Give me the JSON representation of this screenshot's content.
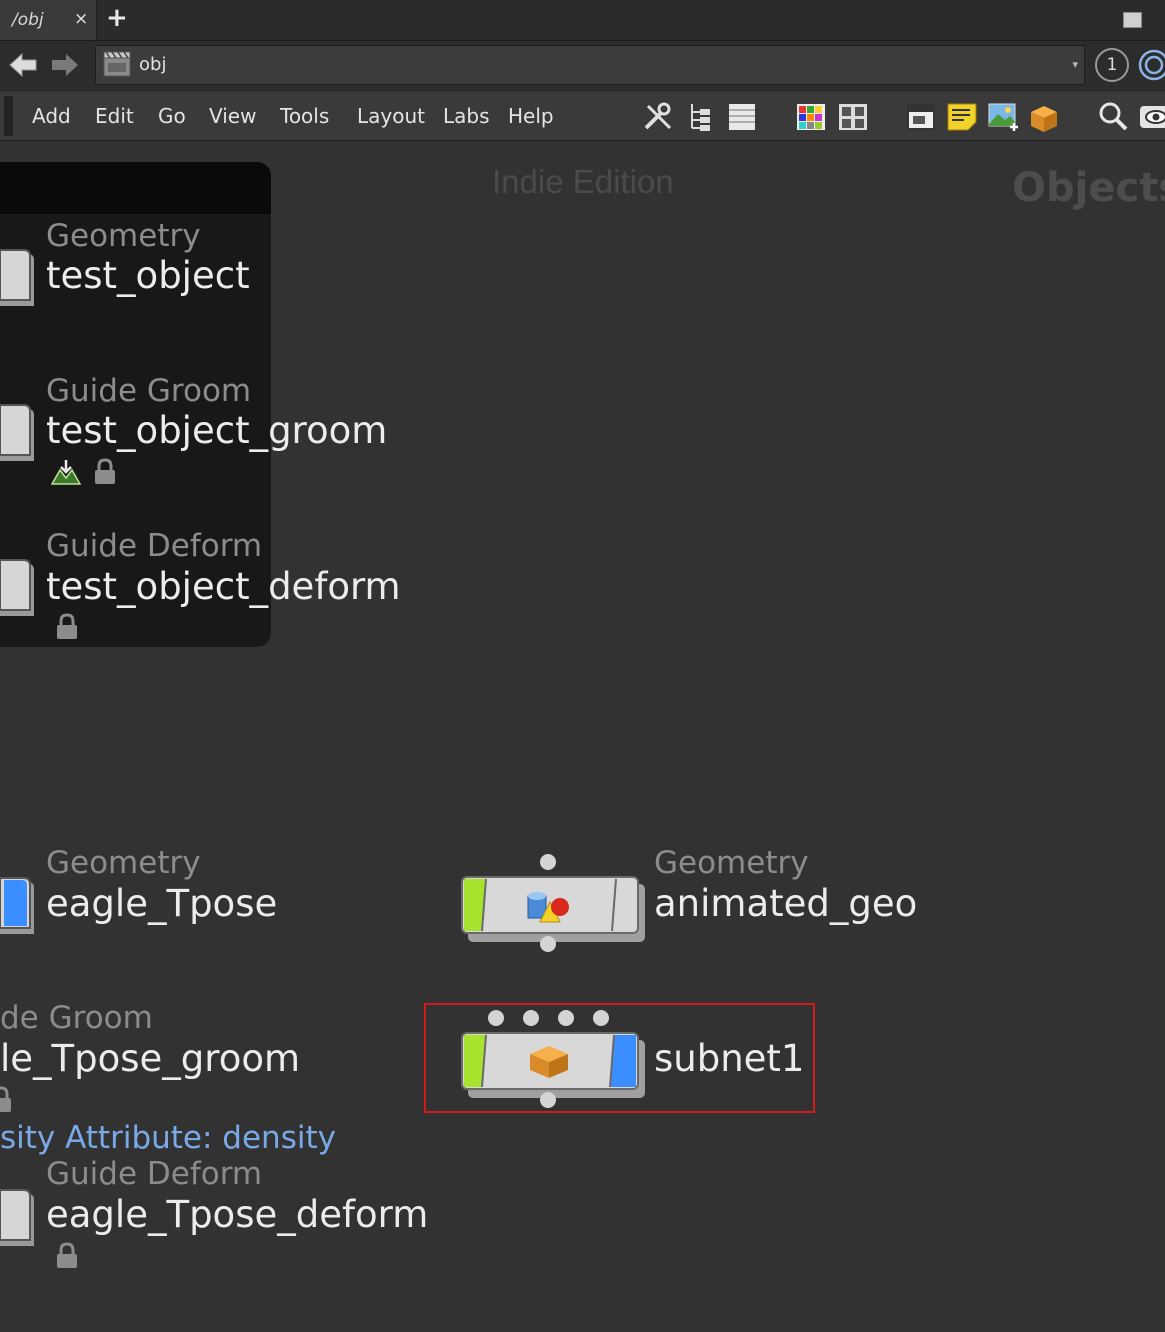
{
  "tab": {
    "label": "/obj",
    "close_glyph": "×",
    "add_glyph": "+"
  },
  "path": {
    "value": "obj",
    "drop_glyph": "▾"
  },
  "viewport_count": "1",
  "menu": [
    "Add",
    "Edit",
    "Go",
    "View",
    "Tools",
    "Layout",
    "Labs",
    "Help"
  ],
  "toolbar_icons": [
    "wrench-icon",
    "tree-icon",
    "list-icon",
    "color-palette-icon",
    "shape-palette-icon",
    "network-box-icon",
    "sticky-note-icon",
    "background-image-icon",
    "subnet-icon",
    "search-icon",
    "eye-icon"
  ],
  "canvas": {
    "watermark": "Indie Edition",
    "context": "Objects"
  },
  "nodes": [
    {
      "type": "Geometry",
      "name": "test_object",
      "flags": []
    },
    {
      "type": "Guide Groom",
      "name": "test_object_groom",
      "flags": [
        "display-icon",
        "lock-icon"
      ]
    },
    {
      "type": "Guide Deform",
      "name": "test_object_deform",
      "flags": [
        "lock-icon"
      ]
    },
    {
      "type": "Geometry",
      "name": "eagle_Tpose",
      "flags": []
    },
    {
      "type": "Geometry",
      "name": "animated_geo",
      "flags": []
    },
    {
      "type": "de Groom",
      "name": "le_Tpose_groom",
      "flags": [
        "lock-icon"
      ],
      "attribute": "sity Attribute: density"
    },
    {
      "type": "",
      "name": "subnet1",
      "flags": []
    },
    {
      "type": "Guide Deform",
      "name": "eagle_Tpose_deform",
      "flags": [
        "lock-icon"
      ]
    }
  ],
  "colors": {
    "accent_green": "#a6e22e",
    "accent_blue": "#3b8eff",
    "selection": "#d21c1c"
  }
}
